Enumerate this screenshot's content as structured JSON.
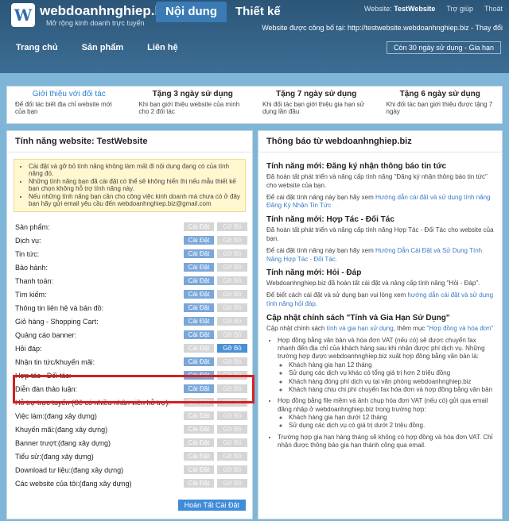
{
  "header": {
    "logo_letter": "W",
    "site_name": "webdoanhnghiep.biz",
    "slogan": "Mở rộng kinh doanh trực tuyến",
    "tab_content": "Nội dung",
    "tab_design": "Thiết kế",
    "website_label": "Website:",
    "website_name": "TestWebsite",
    "help_link": "Trợ giúp",
    "logout_link": "Thoát",
    "published_at": "Website được công bố tại: http://testwebsite.webdoanhnghiep.biz - Thay đổi",
    "trial": "Còn 30 ngày sử dụng - Gia hạn",
    "nav": [
      "Trang chủ",
      "Sản phẩm",
      "Liên hệ"
    ]
  },
  "promo": [
    {
      "title": "Giới thiệu với đối tác",
      "desc": "Để đối tác biết địa chỉ website mới của bạn"
    },
    {
      "title": "Tặng 3 ngày sử dụng",
      "desc": "Khi bạn giới thiệu website của mình cho 2 đối tác"
    },
    {
      "title": "Tặng 7 ngày sử dụng",
      "desc": "Khi đối tác bạn giới thiệu gia hạn sử dụng lần đầu"
    },
    {
      "title": "Tặng 6 ngày sử dụng",
      "desc": "Khi đối tác bạn giới thiệu được tặng 7 ngày"
    }
  ],
  "left": {
    "title": "Tính năng website: TestWebsite",
    "notices": [
      "Cài đặt và gỡ bỏ tính năng không làm mất đi nội dung đang có của tính năng đó.",
      "Những tính năng bạn đã cài đặt có thể sẽ không hiển thị nếu mẫu thiết kế bạn chọn không hỗ trợ tính năng này.",
      "Nếu những tính năng bạn cần cho công việc kinh doanh mà chưa có ở đây bạn hãy gửi email yêu cầu đến webdoanhnghiep.biz@gmail.com"
    ],
    "install_label": "Cài Đặt",
    "remove_label": "Gỡ Bỏ",
    "finish_label": "Hoàn Tất Cài Đặt",
    "features": [
      {
        "name": "Sản phẩm:",
        "state": "none"
      },
      {
        "name": "Dịch vụ:",
        "state": "install"
      },
      {
        "name": "Tin tức:",
        "state": "install"
      },
      {
        "name": "Bảo hành:",
        "state": "install"
      },
      {
        "name": "Thanh toán:",
        "state": "install"
      },
      {
        "name": "Tìm kiếm:",
        "state": "install"
      },
      {
        "name": "Thông tin liên hệ và bản đồ:",
        "state": "install"
      },
      {
        "name": "Giỏ hàng - Shopping Cart:",
        "state": "install"
      },
      {
        "name": "Quảng cáo banner:",
        "state": "install"
      },
      {
        "name": "Hỏi đáp:",
        "state": "remove"
      },
      {
        "name": "Nhận tin tức/khuyến mãi:",
        "state": "install"
      },
      {
        "name": "Hợp tác - Đối tác:",
        "state": "install"
      },
      {
        "name": "Diễn đàn thảo luận:",
        "state": "install"
      },
      {
        "name": "Hỗ trợ trực tuyến (Sẽ có nhiều nhân viên hỗ trợ):",
        "state": "none"
      },
      {
        "name": "Việc làm:(đang xây dựng)",
        "state": "none"
      },
      {
        "name": "Khuyến mãi:(đang xây dựng)",
        "state": "none"
      },
      {
        "name": "Banner trượt:(đang xây dựng)",
        "state": "none"
      },
      {
        "name": "Tiểu sử:(đang xây dựng)",
        "state": "none"
      },
      {
        "name": "Download tư liệu:(đang xây dựng)",
        "state": "none"
      },
      {
        "name": "Các website của tôi:(đang xây dựng)",
        "state": "none"
      }
    ]
  },
  "right": {
    "title": "Thông báo từ webdoanhnghiep.biz",
    "n1_title": "Tính năng mới: Đăng ký nhận thông báo tin tức",
    "n1_p1": "Đã hoàn tất phát triển và nâng cấp tính năng \"Đăng ký nhận thông báo tin tức\" cho website của bạn.",
    "n1_p2": "Để cài đặt tính năng này bạn hãy xem",
    "n1_link": "Hướng dẫn cài đặt và sử dụng tính năng Đăng Ký Nhận Tin Tức",
    "n2_title": "Tính năng mới: Hợp Tác - Đối Tác",
    "n2_p1": "Đã hoàn tất phát triển và nâng cấp tính năng Hợp Tác - Đối Tác cho website của bạn.",
    "n2_p2": "Để cài đặt tính năng này bạn hãy xem",
    "n2_link": "Hướng Dẫn Cài Đặt và Sử Dụng Tính Năng Hợp Tác - Đối Tác.",
    "n3_title": "Tính năng mới: Hỏi - Đáp",
    "n3_p1": "Webdoanhnghiep.biz đã hoàn tất cài đặt và nâng cấp tính năng \"Hỏi - Đáp\".",
    "n3_p2": "Để biết cách cài đặt và sử dụng bạn vui lòng xem",
    "n3_link": "hướng dẫn cài đặt và sử dụng tính năng hỏi đáp.",
    "n4_title": "Cập nhật chính sách \"Tính và Gia Hạn Sử Dụng\"",
    "n4_p1": "Cập nhật chính sách",
    "n4_link1": "tính và gia hạn sử dụng",
    "n4_p1b": ", thêm mục",
    "n4_link2": "\"Hợp đồng và hóa đơn\"",
    "b1": "Hợp đồng bằng văn bản và hóa đơn VAT (nếu có) sẽ được chuyển fax nhanh đến địa chỉ của khách hàng sau khi nhận được phí dịch vụ. Những trường hợp được webdoanhnghiep.biz xuất hợp đồng bằng văn bản là:",
    "b1_sub": [
      "Khách hàng gia hạn 12 tháng",
      "Sử dụng các dịch vụ khác có tổng giá trị hơn 2 triệu đồng",
      "Khách hàng đóng phí dịch vụ tại văn phòng webdoanhnghiep.biz",
      "Khách hàng chịu chi phí chuyển fax hóa đơn và hợp đồng bằng văn bản"
    ],
    "b2": "Hợp đồng bằng file mềm và ảnh chụp hóa đơn VAT (nếu có) gửi qua email đăng nhập ở webdoanhnghiep.biz trong trường hợp:",
    "b2_sub": [
      "Khách hàng gia hạn dưới 12 tháng",
      "Sử dụng các dịch vụ có giá trị dưới 2 triệu đồng."
    ],
    "b3": "Trường hợp gia hạn hàng tháng sẽ không có hợp đồng và hóa đơn VAT. Chỉ nhận được thông báo gia hạn thành công qua email."
  }
}
